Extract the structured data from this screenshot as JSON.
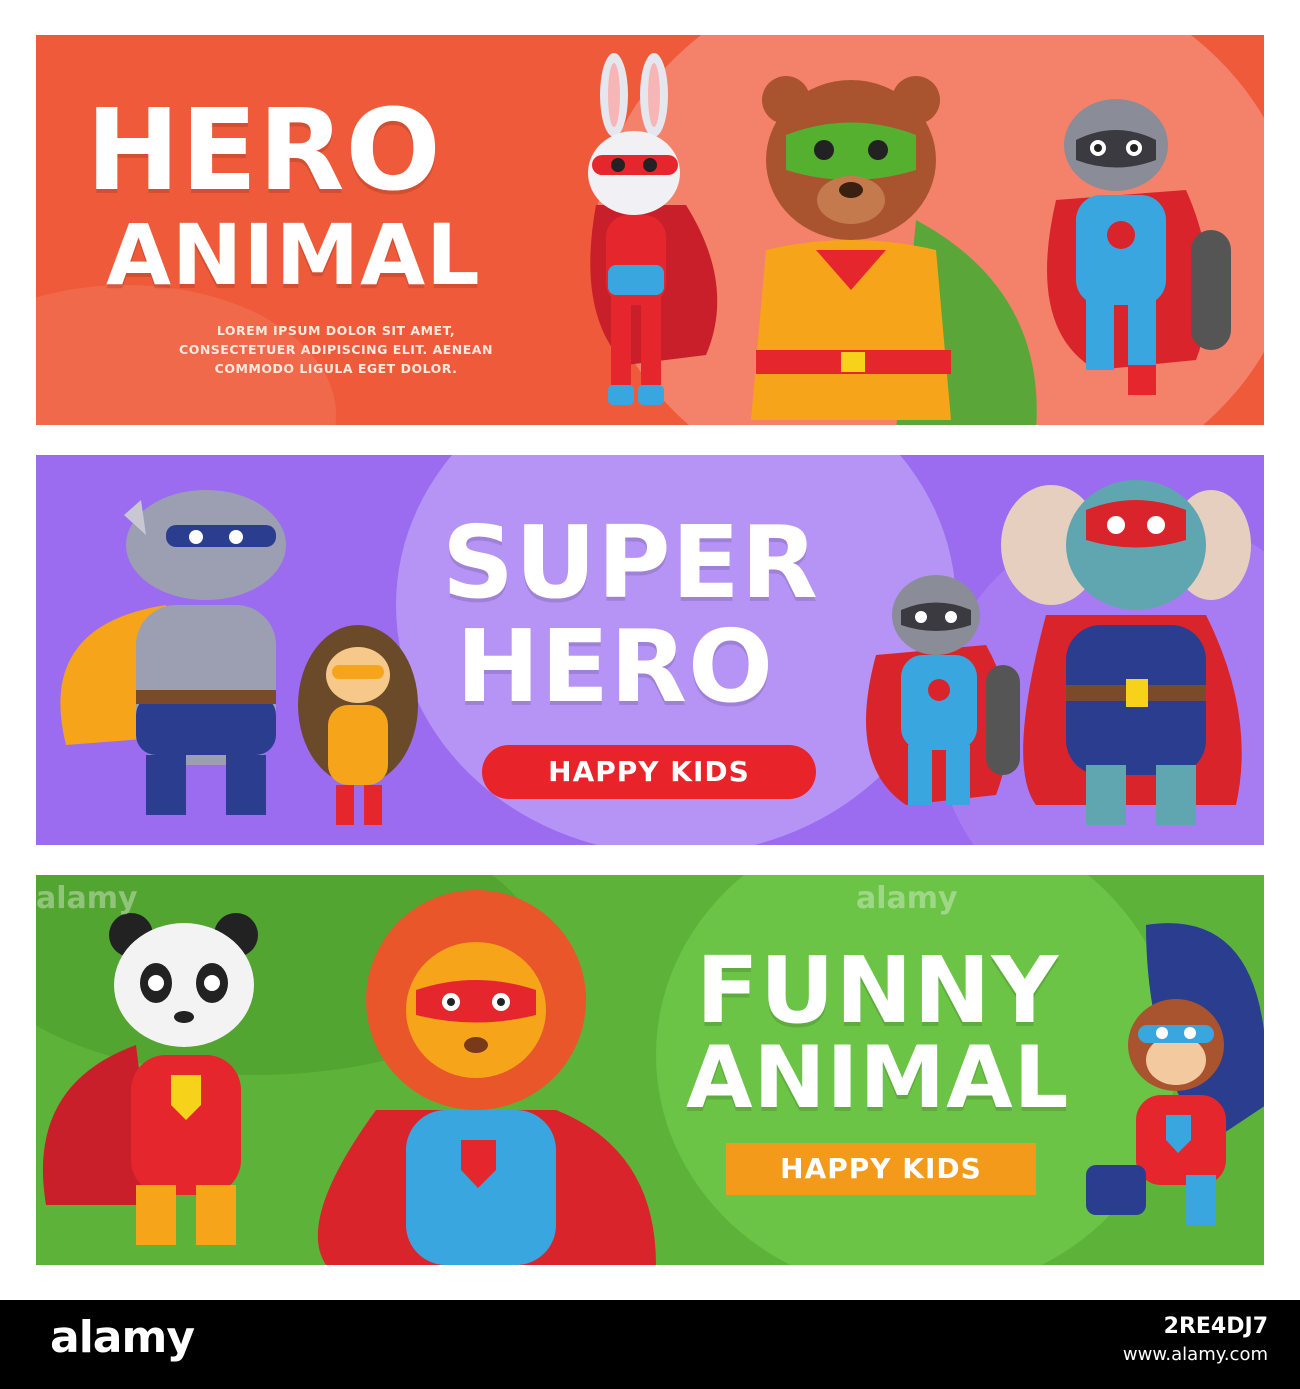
{
  "banner_1": {
    "title_line1": "HERO",
    "title_line2": "ANIMAL",
    "body_line1": "LOREM IPSUM DOLOR SIT AMET,",
    "body_line2": "CONSECTETUER ADIPISCING ELIT. AENEAN",
    "body_line3": "COMMODO LIGULA EGET DOLOR."
  },
  "banner_2": {
    "title_line1": "SUPER",
    "title_line2": "HERO",
    "badge": "HAPPY KIDS"
  },
  "banner_3": {
    "title_line1": "FUNNY",
    "title_line2": "ANIMAL",
    "badge": "HAPPY KIDS"
  },
  "watermark": "alamy",
  "footer": {
    "logo": "alamy",
    "image_code": "2RE4DJ7",
    "url": "www.alamy.com"
  },
  "colors": {
    "banner_1_bg": "#ef5a3a",
    "banner_2_bg": "#9b6cf0",
    "banner_3_bg": "#5db33a",
    "badge_red": "#e8232a",
    "badge_orange": "#f39a1a"
  },
  "characters": {
    "banner_1": [
      "rabbit-hero",
      "bear-hero",
      "raccoon-hero"
    ],
    "banner_2": [
      "rhino-hero",
      "hedgehog-hero",
      "raccoon-hero",
      "elephant-hero"
    ],
    "banner_3": [
      "panda-hero",
      "lion-hero",
      "monkey-hero"
    ]
  }
}
